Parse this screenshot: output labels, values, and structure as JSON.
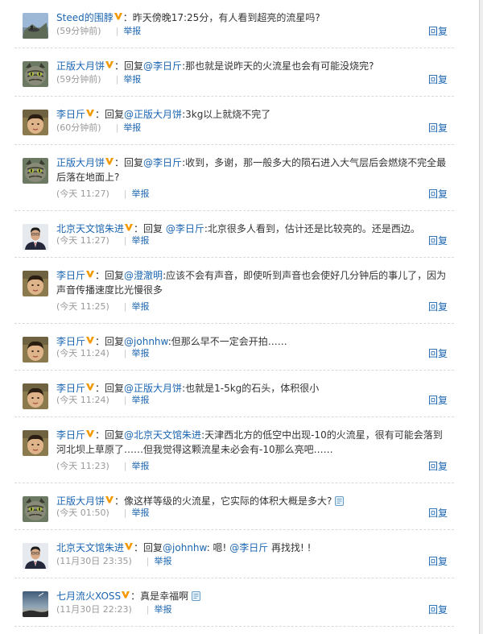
{
  "comments": [
    {
      "user": "Steed的围脖",
      "verified": true,
      "avatar": "landscape-avatar",
      "segments": [
        {
          "t": "昨天傍晚17:25分，有人看到超亮的流星吗?"
        }
      ],
      "time": "(59分钟前)",
      "report": "举报",
      "reply": "回复"
    },
    {
      "user": "正版大月饼",
      "verified": true,
      "avatar": "cat-avatar",
      "segments": [
        {
          "t": "回复"
        },
        {
          "t": "@李日斤",
          "m": true
        },
        {
          "t": ":那也就是说昨天的火流星也会有可能没烧完?"
        }
      ],
      "time": "(59分钟前)",
      "report": "举报",
      "reply": "回复"
    },
    {
      "user": "李日斤",
      "verified": true,
      "avatar": "child-avatar",
      "segments": [
        {
          "t": "回复"
        },
        {
          "t": "@正版大月饼",
          "m": true
        },
        {
          "t": ":3kg以上就烧不完了"
        }
      ],
      "time": "(60分钟前)",
      "report": "举报",
      "reply": "回复"
    },
    {
      "user": "正版大月饼",
      "verified": true,
      "avatar": "cat-avatar",
      "segments": [
        {
          "t": "回复"
        },
        {
          "t": "@李日斤",
          "m": true
        },
        {
          "t": ":收到，多谢，那一般多大的陨石进入大气层后会燃烧不完全最后落在地面上?"
        }
      ],
      "time": "(今天 11:27)",
      "report": "举报",
      "reply": "回复"
    },
    {
      "user": "北京天文馆朱进",
      "verified": true,
      "avatar": "man-avatar",
      "segments": [
        {
          "t": "回复 "
        },
        {
          "t": "@李日斤",
          "m": true
        },
        {
          "t": ":北京很多人看到，估计还是比较亮的。还是西边。"
        }
      ],
      "time": "(今天 11:27)",
      "report": "举报",
      "reply": "回复"
    },
    {
      "user": "李日斤",
      "verified": true,
      "avatar": "child-avatar",
      "segments": [
        {
          "t": "回复"
        },
        {
          "t": "@澄澈明",
          "m": true
        },
        {
          "t": ":应该不会有声音，即使听到声音也会使好几分钟后的事儿了，因为声音传播速度比光慢很多"
        }
      ],
      "time": "(今天 11:25)",
      "report": "举报",
      "reply": "回复"
    },
    {
      "user": "李日斤",
      "verified": true,
      "avatar": "child-avatar",
      "segments": [
        {
          "t": "回复"
        },
        {
          "t": "@johnhw",
          "m": true
        },
        {
          "t": ":但那么早不一定会开拍……"
        }
      ],
      "time": "(今天 11:24)",
      "report": "举报",
      "reply": "回复"
    },
    {
      "user": "李日斤",
      "verified": true,
      "avatar": "child-avatar",
      "segments": [
        {
          "t": "回复"
        },
        {
          "t": "@正版大月饼",
          "m": true
        },
        {
          "t": ":也就是1-5kg的石头，体积很小"
        }
      ],
      "time": "(今天 11:24)",
      "report": "举报",
      "reply": "回复"
    },
    {
      "user": "李日斤",
      "verified": true,
      "avatar": "child-avatar",
      "segments": [
        {
          "t": "回复"
        },
        {
          "t": "@北京天文馆朱进",
          "m": true
        },
        {
          "t": ":天津西北方的低空中出现-10的火流星，很有可能会落到河北坝上草原了……但我觉得这颗流星未必会有-10那么亮吧……"
        }
      ],
      "time": "(今天 11:23)",
      "report": "举报",
      "reply": "回复"
    },
    {
      "user": "正版大月饼",
      "verified": true,
      "avatar": "cat-avatar",
      "segments": [
        {
          "t": "像这样等级的火流星，它实际的体积大概是多大?"
        }
      ],
      "emoticon": true,
      "time": "(今天 01:50)",
      "report": "举报",
      "reply": "回复"
    },
    {
      "user": "北京天文馆朱进",
      "verified": true,
      "avatar": "man-avatar",
      "segments": [
        {
          "t": "回复"
        },
        {
          "t": "@johnhw",
          "m": true
        },
        {
          "t": ": 嗯! "
        },
        {
          "t": "@李日斤",
          "m": true
        },
        {
          "t": " 再找找! !"
        }
      ],
      "time": "(11月30日 23:35)",
      "report": "举报",
      "reply": "回复"
    },
    {
      "user": "七月流火XOSS",
      "verified": true,
      "avatar": "sky-avatar",
      "segments": [
        {
          "t": "真是幸福啊"
        }
      ],
      "emoticon": true,
      "time": "(11月30日 22:23)",
      "report": "举报",
      "reply": "回复"
    }
  ],
  "colors": {
    "link": "#1b65b1",
    "meta": "#9a9a9a",
    "badge": "#f39800"
  }
}
